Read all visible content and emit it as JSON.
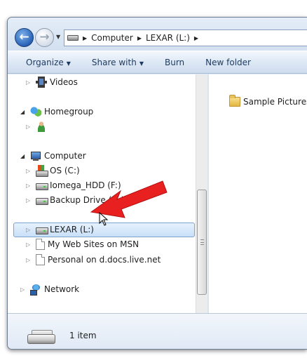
{
  "address": {
    "path": [
      "Computer",
      "LEXAR (L:)"
    ]
  },
  "toolbar": {
    "organize": "Organize",
    "share_with": "Share with",
    "burn": "Burn",
    "new_folder": "New folder"
  },
  "nav": {
    "videos": "Videos",
    "homegroup": "Homegroup",
    "computer": "Computer",
    "drives": [
      {
        "label": "OS (C:)"
      },
      {
        "label": "Iomega_HDD (F:)"
      },
      {
        "label": "Backup Drive (G:)"
      },
      {
        "label": "LEXAR (L:)"
      }
    ],
    "places": [
      {
        "label": "My Web Sites on MSN"
      },
      {
        "label": "Personal on d.docs.live.net"
      }
    ],
    "network": "Network"
  },
  "content": {
    "items": [
      {
        "label": "Sample Pictures"
      }
    ]
  },
  "details": {
    "count": "1 item"
  },
  "colors": {
    "selection_border": "#7da2ce",
    "annotation_arrow": "#e8201f",
    "toolbar_text": "#1e3a5f"
  }
}
